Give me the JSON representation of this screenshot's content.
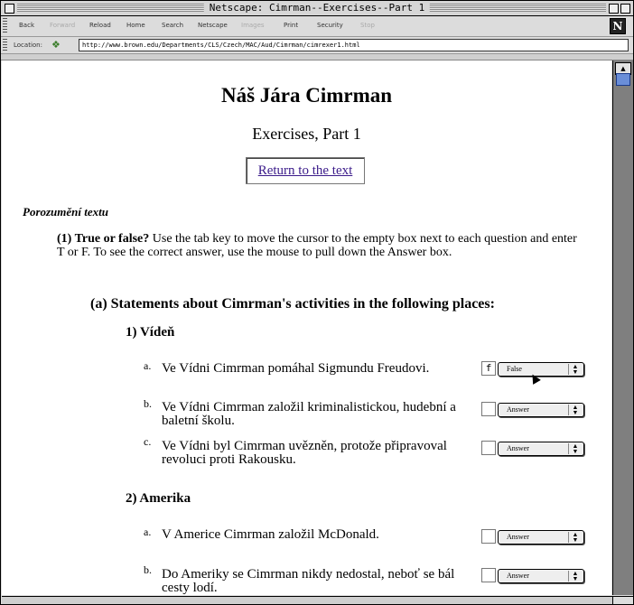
{
  "window": {
    "title": "Netscape: Cimrman--Exercises--Part 1"
  },
  "toolbar": {
    "back": "Back",
    "forward": "Forward",
    "reload": "Reload",
    "home": "Home",
    "search": "Search",
    "netscape": "Netscape",
    "images": "Images",
    "print": "Print",
    "security": "Security",
    "stop": "Stop"
  },
  "location": {
    "label": "Location:",
    "url": "http://www.brown.edu/Departments/CLS/Czech/MAC/Aud/Cimrman/cimrexer1.html"
  },
  "page": {
    "title": "Náš Jára Cimrman",
    "subtitle": "Exercises, Part 1",
    "return_link": "Return to the text",
    "section_heading": "Porozumění textu",
    "q1_label": "(1) True or false?",
    "q1_instructions": " Use the tab key to move the cursor to the empty box next to each question and enter T or F. To see the correct answer, use the mouse to pull down the Answer box.",
    "subheading": "(a) Statements about Cimrman's activities in the following places:"
  },
  "places": [
    {
      "name": "1) Vídeň",
      "statements": [
        {
          "letter": "a.",
          "text": "Ve Vídni Cimrman pomáhal Sigmundu Freudovi.",
          "entry": "f",
          "select": "False"
        },
        {
          "letter": "b.",
          "text": "Ve Vídni Cimrman založil kriminalistickou, hudební a baletní školu.",
          "entry": "",
          "select": "Answer"
        },
        {
          "letter": "c.",
          "text": "Ve Vídni byl Cimrman uvězněn, protože připravoval revoluci proti Rakousku.",
          "entry": "",
          "select": "Answer"
        }
      ]
    },
    {
      "name": "2) Amerika",
      "statements": [
        {
          "letter": "a.",
          "text": "V Americe Cimrman založil McDonald.",
          "entry": "",
          "select": "Answer"
        },
        {
          "letter": "b.",
          "text": "Do Ameriky se Cimrman nikdy nedostal, neboť se bál cesty lodí.",
          "entry": "",
          "select": "Answer"
        }
      ]
    }
  ]
}
